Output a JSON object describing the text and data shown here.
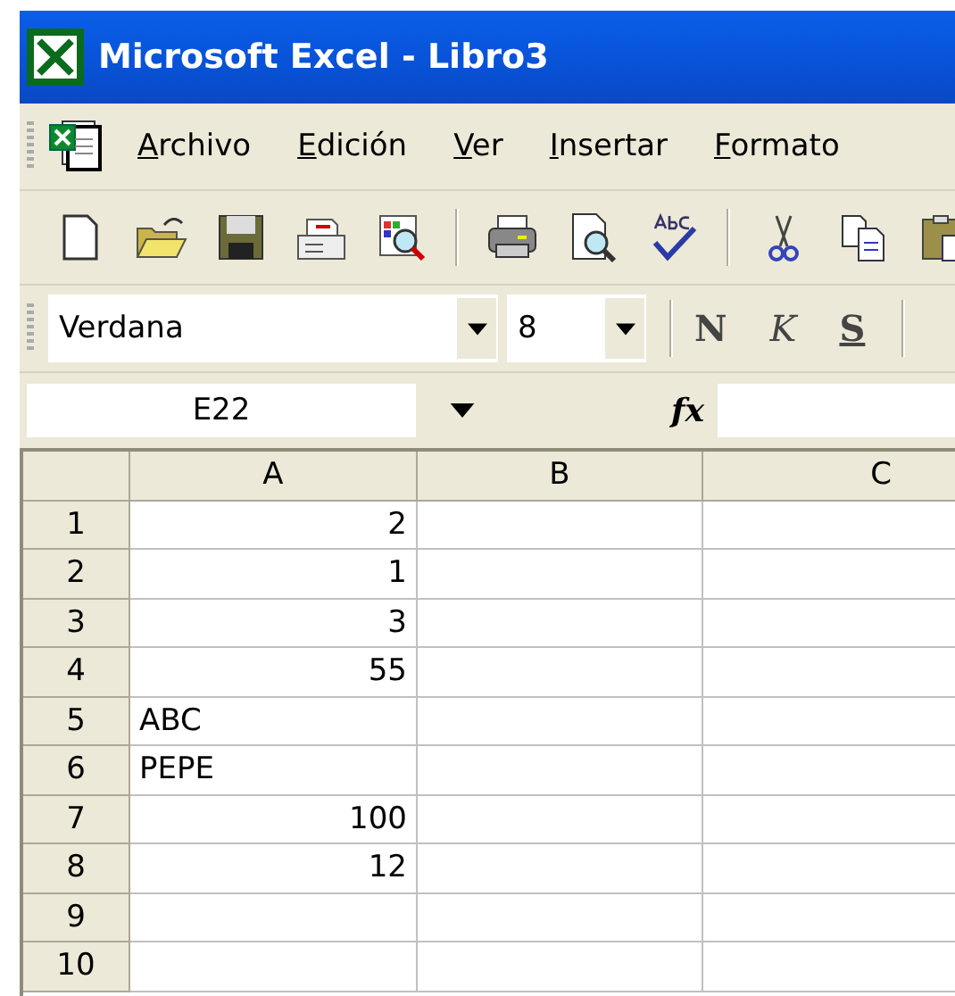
{
  "window": {
    "title": "Microsoft Excel - Libro3"
  },
  "menu": [
    {
      "label": "Archivo"
    },
    {
      "label": "Edición"
    },
    {
      "label": "Ver"
    },
    {
      "label": "Insertar"
    },
    {
      "label": "Formato"
    }
  ],
  "toolbar": [
    {
      "kind": "new"
    },
    {
      "kind": "open"
    },
    {
      "kind": "save"
    },
    {
      "kind": "mail"
    },
    {
      "kind": "search"
    },
    {
      "kind": "sep"
    },
    {
      "kind": "print"
    },
    {
      "kind": "preview"
    },
    {
      "kind": "spell"
    },
    {
      "kind": "sep"
    },
    {
      "kind": "cut"
    },
    {
      "kind": "copy"
    },
    {
      "kind": "paste"
    }
  ],
  "format_bar": {
    "font": "Verdana",
    "size": "8",
    "buttons": [
      {
        "kind": "bold",
        "label": "N"
      },
      {
        "kind": "italic",
        "label": "K"
      },
      {
        "kind": "underline",
        "label": "S"
      }
    ]
  },
  "formula_bar": {
    "name_box": "E22",
    "fx": "fx"
  },
  "sheet": {
    "columns": [
      "A",
      "B",
      "C"
    ],
    "rows": [
      {
        "header": "1",
        "cells": [
          {
            "value": "2",
            "kind": "number"
          },
          {},
          {}
        ]
      },
      {
        "header": "2",
        "cells": [
          {
            "value": "1",
            "kind": "number"
          },
          {},
          {}
        ]
      },
      {
        "header": "3",
        "cells": [
          {
            "value": "3",
            "kind": "number"
          },
          {},
          {}
        ]
      },
      {
        "header": "4",
        "cells": [
          {
            "value": "55",
            "kind": "number"
          },
          {},
          {}
        ]
      },
      {
        "header": "5",
        "cells": [
          {
            "value": "ABC",
            "kind": "text"
          },
          {},
          {}
        ]
      },
      {
        "header": "6",
        "cells": [
          {
            "value": "PEPE",
            "kind": "text"
          },
          {},
          {}
        ]
      },
      {
        "header": "7",
        "cells": [
          {
            "value": "100",
            "kind": "number"
          },
          {},
          {}
        ]
      },
      {
        "header": "8",
        "cells": [
          {
            "value": "12",
            "kind": "number"
          },
          {},
          {}
        ]
      },
      {
        "header": "9",
        "cells": [
          {},
          {},
          {}
        ]
      },
      {
        "header": "10",
        "cells": [
          {},
          {},
          {}
        ]
      }
    ]
  }
}
